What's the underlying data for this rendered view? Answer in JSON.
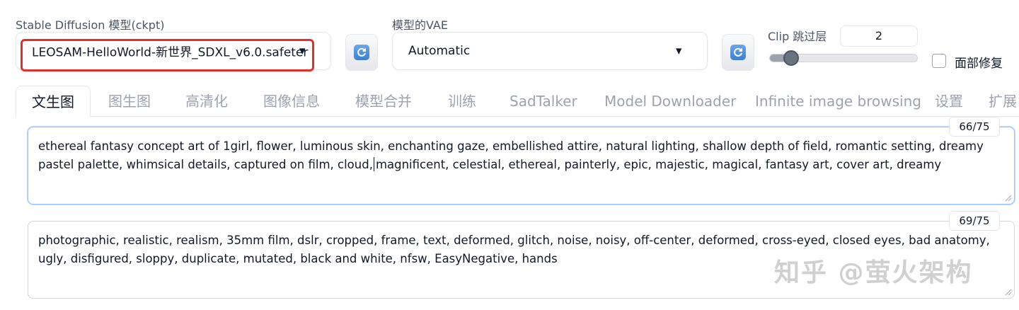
{
  "checkpoint": {
    "label": "Stable Diffusion 模型(ckpt)",
    "value": "LEOSAM-HelloWorld-新世界_SDXL_v6.0.safeter",
    "highlight_color": "#e0302a"
  },
  "vae": {
    "label": "模型的VAE",
    "value": "Automatic"
  },
  "clip": {
    "label": "Clip 跳过层",
    "value": "2",
    "slider_fraction": 0.1
  },
  "face_restore": {
    "label": "面部修复",
    "checked": false
  },
  "tabs": [
    {
      "label": "文生图"
    },
    {
      "label": "图生图"
    },
    {
      "label": "高清化"
    },
    {
      "label": "图像信息"
    },
    {
      "label": "模型合并"
    },
    {
      "label": "训练"
    },
    {
      "label": "SadTalker"
    },
    {
      "label": "Model Downloader"
    },
    {
      "label": "Infinite image browsing"
    },
    {
      "label": "设置"
    },
    {
      "label": "扩展"
    }
  ],
  "prompt": {
    "counter": "66/75",
    "text_before_cursor": "ethereal fantasy concept art of  1girl, flower, luminous skin, enchanting gaze, embellished attire, natural lighting, shallow depth of field, romantic setting, dreamy pastel palette, whimsical details, captured on film, cloud,",
    "text_after_cursor": "magnificent, celestial, ethereal, painterly, epic, majestic, magical, fantasy art, cover art, dreamy"
  },
  "negative_prompt": {
    "counter": "69/75",
    "text": "photographic, realistic, realism, 35mm film, dslr, cropped, frame, text, deformed, glitch, noise, noisy, off-center, deformed, cross-eyed, closed eyes, bad anatomy, ugly, disfigured, sloppy, duplicate, mutated, black and white, nfsw, EasyNegative, hands"
  },
  "watermark": "知乎 @萤火架构",
  "icons": {
    "refresh": "refresh-icon",
    "caret": "chevron-down-icon",
    "resize": "resize-handle-icon"
  }
}
